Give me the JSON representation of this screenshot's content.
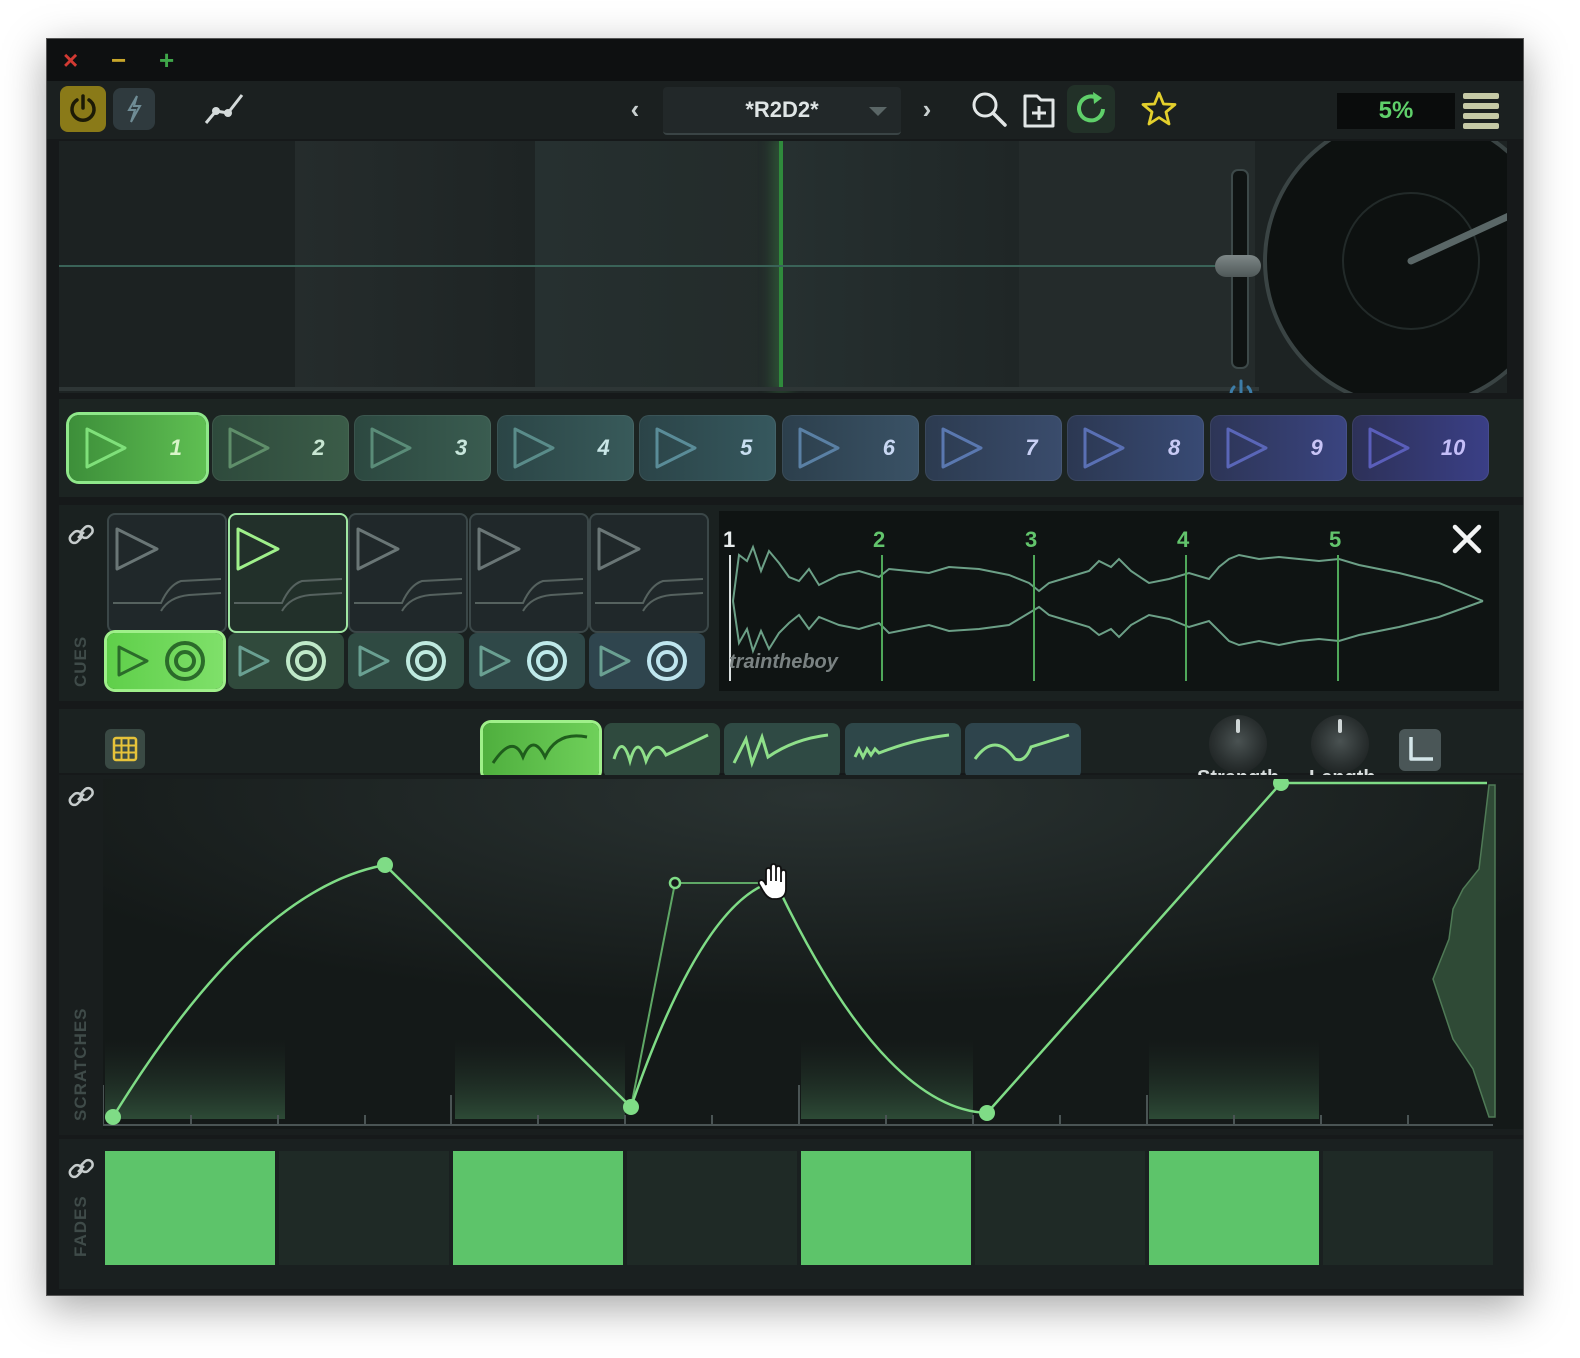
{
  "window": {
    "controls": {
      "close": "×",
      "minimize": "−",
      "maximize": "+"
    }
  },
  "toolbar": {
    "prev": "‹",
    "next": "›",
    "preset_name": "*R2D2*",
    "percent": "5%",
    "icons": [
      "power-icon",
      "flash-icon",
      "curve-icon",
      "search-icon",
      "add-preset-icon",
      "reload-icon",
      "star-icon",
      "menu-icon"
    ]
  },
  "cue_buttons": [
    "1",
    "2",
    "3",
    "4",
    "5",
    "6",
    "7",
    "8",
    "9",
    "10"
  ],
  "cues": {
    "label": "CUES",
    "selected_index": 1,
    "markers": [
      "1",
      "2",
      "3",
      "4",
      "5"
    ],
    "artist": "traintheboy"
  },
  "scratches": {
    "label": "SCRATCHES",
    "selected_shape": 0,
    "strength_label": "Strength",
    "length_label": "Length"
  },
  "fades": {
    "label": "FADES",
    "pattern": [
      1,
      0,
      1,
      0,
      1,
      0,
      1,
      0
    ]
  },
  "colors": {
    "accent": "#5fd06a",
    "power": "#c9b22a",
    "star": "#e3cf2c"
  }
}
